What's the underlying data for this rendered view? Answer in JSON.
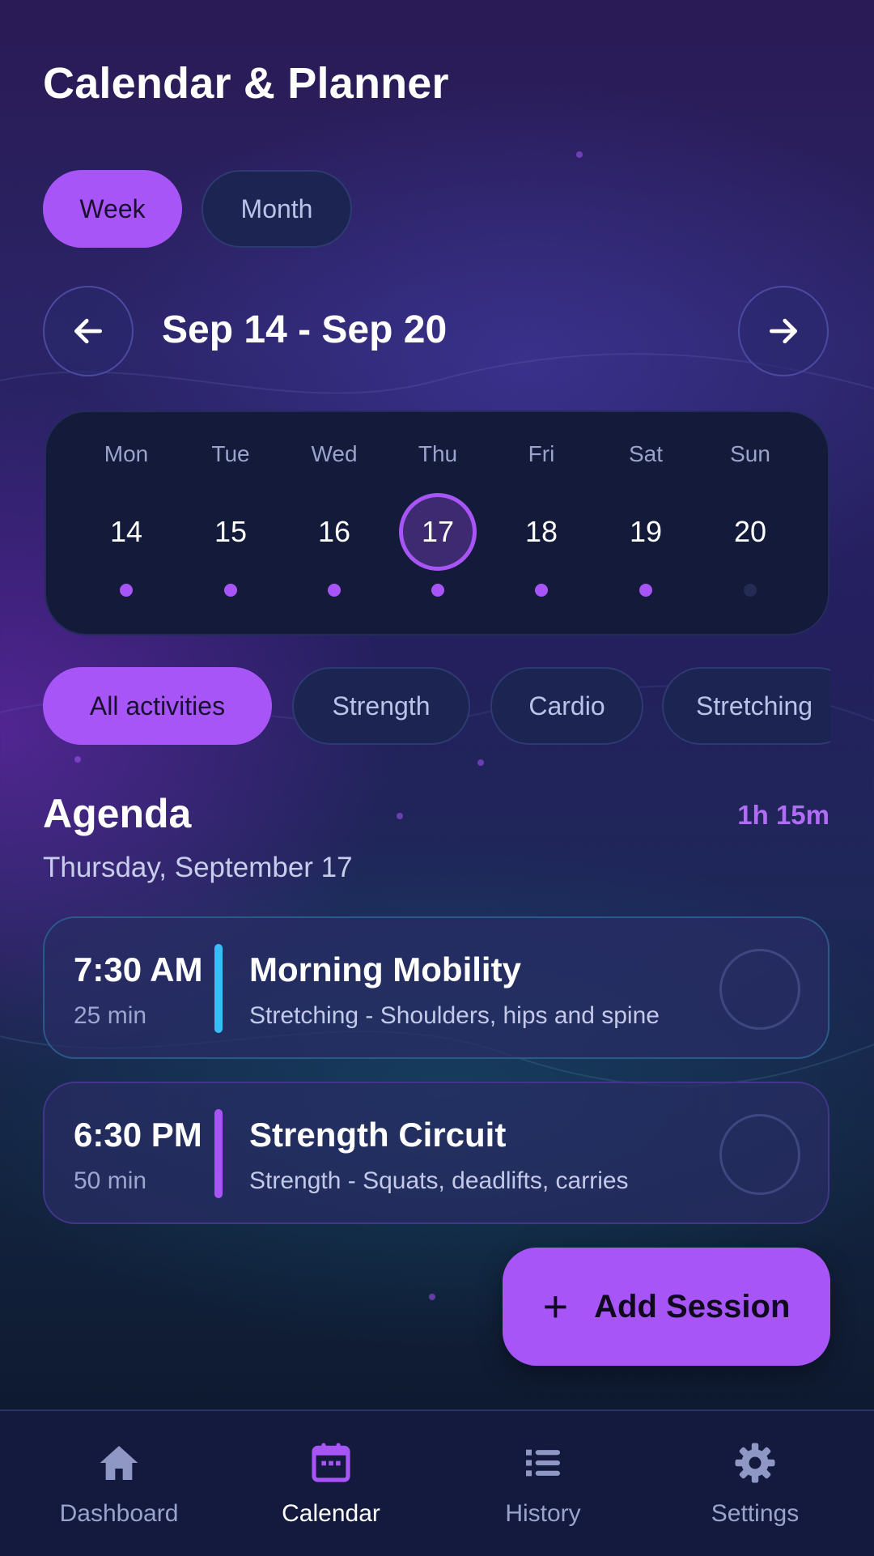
{
  "header": {
    "title": "Calendar & Planner"
  },
  "view_toggle": {
    "week_label": "Week",
    "month_label": "Month",
    "selected": "Week"
  },
  "week_nav": {
    "range_label": "Sep 14 - Sep 20",
    "prev_icon": "arrow-left-icon",
    "next_icon": "arrow-right-icon"
  },
  "week": {
    "days": [
      {
        "name": "Mon",
        "num": "14",
        "has_session": true
      },
      {
        "name": "Tue",
        "num": "15",
        "has_session": true
      },
      {
        "name": "Wed",
        "num": "16",
        "has_session": true
      },
      {
        "name": "Thu",
        "num": "17",
        "has_session": true,
        "selected": true
      },
      {
        "name": "Fri",
        "num": "18",
        "has_session": true
      },
      {
        "name": "Sat",
        "num": "19",
        "has_session": true
      },
      {
        "name": "Sun",
        "num": "20",
        "has_session": false
      }
    ]
  },
  "filters": [
    {
      "label": "All activities",
      "active": true
    },
    {
      "label": "Strength",
      "active": false
    },
    {
      "label": "Cardio",
      "active": false
    },
    {
      "label": "Stretching",
      "active": false
    }
  ],
  "agenda": {
    "title": "Agenda",
    "total": "1h 15m",
    "date": "Thursday, September 17",
    "sessions": [
      {
        "time": "7:30 AM",
        "duration": "25 min",
        "name": "Morning Mobility",
        "description": "Stretching - Shoulders, hips and spine",
        "accent": "#38bdf8"
      },
      {
        "time": "6:30 PM",
        "duration": "50 min",
        "name": "Strength Circuit",
        "description": "Strength - Squats, deadlifts, carries",
        "accent": "#a855f7"
      }
    ]
  },
  "fab": {
    "label": "Add Session",
    "icon": "plus-icon"
  },
  "bottom_nav": [
    {
      "label": "Dashboard",
      "icon": "home-icon",
      "active": false
    },
    {
      "label": "Calendar",
      "icon": "calendar-icon",
      "active": true
    },
    {
      "label": "History",
      "icon": "list-icon",
      "active": false
    },
    {
      "label": "Settings",
      "icon": "gear-icon",
      "active": false
    }
  ],
  "colors": {
    "accent": "#a855f7",
    "cardio_blue": "#38bdf8",
    "dot_empty": "#252c54"
  }
}
